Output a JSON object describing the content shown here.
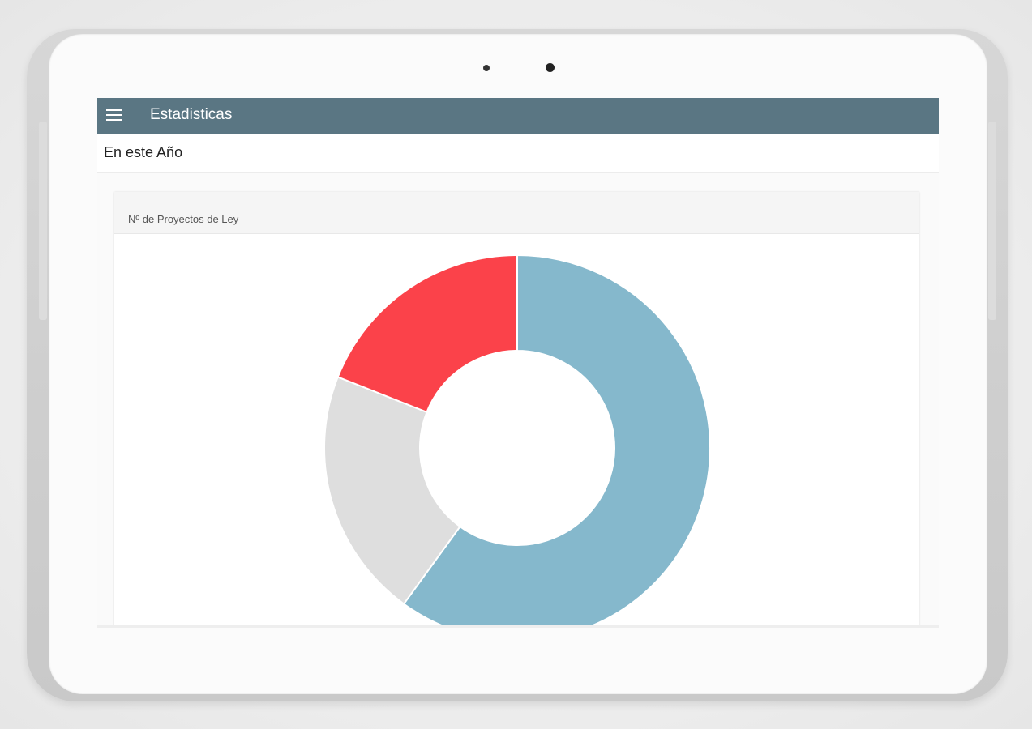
{
  "app": {
    "title": "Estadisticas",
    "menu_icon": "hamburger-menu-icon"
  },
  "section": {
    "title": "En este Año"
  },
  "card": {
    "title": "Nº de Proyectos de Ley"
  },
  "colors": {
    "appbar": "#5a7683",
    "slice_blue": "#85b8cc",
    "slice_gray": "#dedede",
    "slice_red": "#fb424a"
  },
  "chart_data": {
    "type": "pie",
    "variant": "donut",
    "slices": [
      {
        "value": 0.6,
        "color": "#85b8cc"
      },
      {
        "value": 0.21,
        "color": "#dedede"
      },
      {
        "value": 0.19,
        "color": "#fb424a"
      }
    ]
  }
}
